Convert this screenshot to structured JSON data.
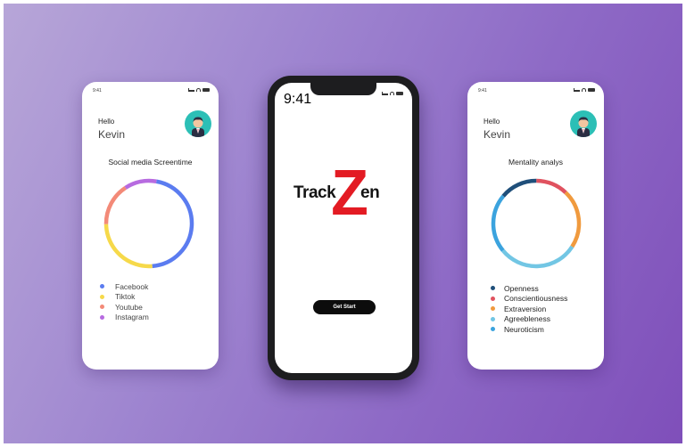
{
  "status": {
    "time": "9:41"
  },
  "left_card": {
    "greeting": "Hello",
    "user_name": "Kevin",
    "title": "Social media Screentime",
    "legend": [
      {
        "label": "Facebook",
        "color": "#5b7cf0"
      },
      {
        "label": "Tiktok",
        "color": "#f6d94a"
      },
      {
        "label": "Youtube",
        "color": "#f38a78"
      },
      {
        "label": "Instagram",
        "color": "#b76be0"
      }
    ],
    "ring_segments": [
      {
        "label": "Facebook",
        "fraction": 0.46,
        "color": "#5b7cf0"
      },
      {
        "label": "Tiktok",
        "fraction": 0.26,
        "color": "#f6d94a"
      },
      {
        "label": "Youtube",
        "fraction": 0.16,
        "color": "#f38a78"
      },
      {
        "label": "Instagram",
        "fraction": 0.12,
        "color": "#b76be0"
      }
    ]
  },
  "center": {
    "logo_left": "Track",
    "logo_letter": "Z",
    "logo_right": "en",
    "cta_label": "Get Start"
  },
  "right_card": {
    "greeting": "Hello",
    "user_name": "Kevin",
    "title": "Mentality analys",
    "legend": [
      {
        "label": "Openness",
        "color": "#1f4f7a"
      },
      {
        "label": "Conscientiousness",
        "color": "#e0525f"
      },
      {
        "label": "Extraversion",
        "color": "#f09a3e"
      },
      {
        "label": "Agreebleness",
        "color": "#72c6e4"
      },
      {
        "label": "Neuroticism",
        "color": "#3ba3de"
      }
    ],
    "ring_segments": [
      {
        "label": "Openness",
        "fraction": 0.14,
        "color": "#1f4f7a"
      },
      {
        "label": "Conscientiousness",
        "fraction": 0.12,
        "color": "#e0525f"
      },
      {
        "label": "Extraversion",
        "fraction": 0.22,
        "color": "#f09a3e"
      },
      {
        "label": "Agreebleness",
        "fraction": 0.3,
        "color": "#72c6e4"
      },
      {
        "label": "Neuroticism",
        "fraction": 0.22,
        "color": "#3ba3de"
      }
    ]
  }
}
